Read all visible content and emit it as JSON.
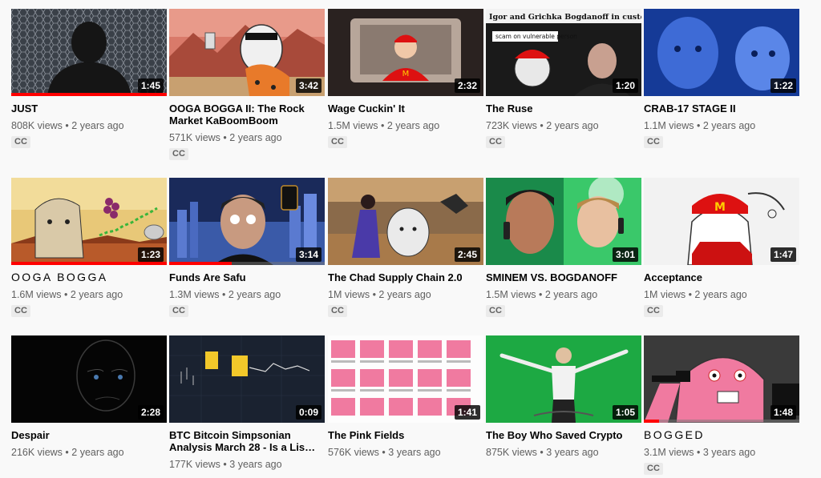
{
  "colors": {
    "progress": "#ff0000",
    "meta": "#606060",
    "title": "#030303"
  },
  "videos": [
    {
      "title": "JUST",
      "views": "808K views",
      "age": "2 years ago",
      "duration": "1:45",
      "cc": "CC",
      "watched": 1.0,
      "thumb_icon": "silhouette-behind-fence"
    },
    {
      "title": "OOGA BOGGA II: The Rock Market KaBoomBoom",
      "views": "571K views",
      "age": "2 years ago",
      "duration": "3:42",
      "cc": "CC",
      "watched": 0.0,
      "thumb_icon": "cartoon-caveman-desert"
    },
    {
      "title": "Wage Cuckin' It",
      "views": "1.5M views",
      "age": "2 years ago",
      "duration": "2:32",
      "cc": "CC",
      "watched": 0.0,
      "thumb_icon": "fast-food-worker"
    },
    {
      "title": "The Ruse",
      "views": "723K views",
      "age": "2 years ago",
      "duration": "1:20",
      "cc": "CC",
      "watched": 0.0,
      "thumb_icon": "news-headline-collage",
      "thumb_text_1": "Igor and Grichka Bogdanoff in custody",
      "thumb_text_2": "scam on vulnerable person"
    },
    {
      "title": "CRAB-17 STAGE II",
      "views": "1.1M views",
      "age": "2 years ago",
      "duration": "1:22",
      "cc": "CC",
      "watched": 0.0,
      "thumb_icon": "blue-tinted-faces"
    },
    {
      "title": "OOGA BOGGA",
      "views": "1.6M views",
      "age": "2 years ago",
      "duration": "1:23",
      "cc": "CC",
      "watched": 1.0,
      "thumb_icon": "wojak-sunset-grapes"
    },
    {
      "title": "Funds Are Safu",
      "views": "1.3M views",
      "age": "2 years ago",
      "duration": "3:14",
      "cc": "CC",
      "watched": 0.4,
      "thumb_icon": "glowing-eyes-city"
    },
    {
      "title": "The Chad Supply Chain 2.0",
      "views": "1M views",
      "age": "2 years ago",
      "duration": "2:45",
      "cc": "CC",
      "watched": 0.0,
      "thumb_icon": "wojak-warehouse"
    },
    {
      "title": "SMINEM VS. BOGDANOFF",
      "views": "1.5M views",
      "age": "2 years ago",
      "duration": "3:01",
      "cc": "CC",
      "watched": 0.0,
      "thumb_icon": "phone-call-faces"
    },
    {
      "title": "Acceptance",
      "views": "1M views",
      "age": "2 years ago",
      "duration": "1:47",
      "cc": "CC",
      "watched": 0.0,
      "thumb_icon": "wojak-cap-sketch"
    },
    {
      "title": "Despair",
      "views": "216K views",
      "age": "2 years ago",
      "duration": "2:28",
      "cc": "",
      "watched": 0.0,
      "thumb_icon": "dark-face"
    },
    {
      "title": "BTC Bitcoin Simpsonian Analysis March 28 - Is a Lis…",
      "views": "177K views",
      "age": "3 years ago",
      "duration": "0:09",
      "cc": "",
      "watched": 0.0,
      "thumb_icon": "simpson-chart"
    },
    {
      "title": "The Pink Fields",
      "views": "576K views",
      "age": "3 years ago",
      "duration": "1:41",
      "cc": "",
      "watched": 0.0,
      "thumb_icon": "pink-wojak-grid"
    },
    {
      "title": "The Boy Who Saved Crypto",
      "views": "875K views",
      "age": "3 years ago",
      "duration": "1:05",
      "cc": "",
      "watched": 0.0,
      "thumb_icon": "man-green-screen"
    },
    {
      "title": "BOGGED",
      "views": "3.1M views",
      "age": "3 years ago",
      "duration": "1:48",
      "cc": "CC",
      "watched": 0.1,
      "thumb_icon": "pink-wojak-gun"
    }
  ]
}
